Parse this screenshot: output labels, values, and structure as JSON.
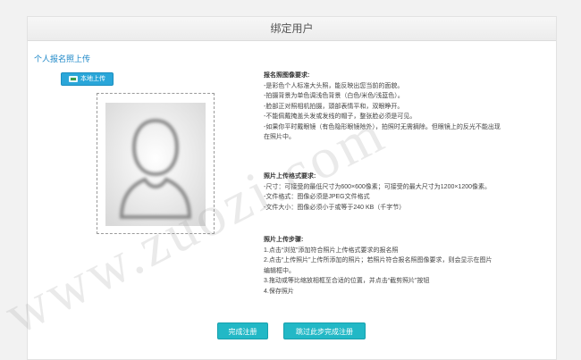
{
  "header": {
    "title": "绑定用户"
  },
  "section": {
    "title": "个人报名照上传"
  },
  "upload": {
    "label": "本地上传",
    "icon": "image-upload-icon"
  },
  "photo_requirements": {
    "heading": "报名照图像要求:",
    "lines": [
      "-是彩色个人标准大头照，能反映出您当前的面貌。",
      "-拍摄背景为单色调浅色背景（白色/米色/浅蓝色）。",
      "-脸部正对照相机拍摄，頭部表情平和，双眼睁开。",
      "-不能佩戴掩盖头发或发线的帽子，整张脸必须是可见。",
      "-如果你平时戴眼镜（有色隐形眼镜除外），拍照时无需摘除。但眼镜上的反光不能出现",
      "在照片中。"
    ]
  },
  "format_requirements": {
    "heading": "照片上传格式要求:",
    "lines": [
      "-尺寸：可接受的最低尺寸为600×600像素；可接受的最大尺寸为1200×1200像素。",
      "-文件格式：图像必须是JPEG文件格式",
      "-文件大小：图像必须小于或等于240 KB（千字节）"
    ]
  },
  "steps": {
    "heading": "照片上传步骤:",
    "lines": [
      "1.点击“浏览”添加符合照片上传格式要求的报名照",
      "2.点击“上传照片”上传所添加的照片；若照片符合报名照图像要求，则会显示在图片",
      "编辑框中。",
      "3.拖动或等比缩放相框至合适的位置，并点击“截剪照片”按钮",
      "4.保存照片"
    ]
  },
  "actions": {
    "complete": "完成注册",
    "skip": "跳过此步完成注册"
  },
  "watermark": {
    "text": "www.zuozi.com"
  },
  "colors": {
    "accent_blue": "#1e88c8",
    "button_teal": "#22b8c6",
    "upload_blue": "#2aa6d9"
  }
}
